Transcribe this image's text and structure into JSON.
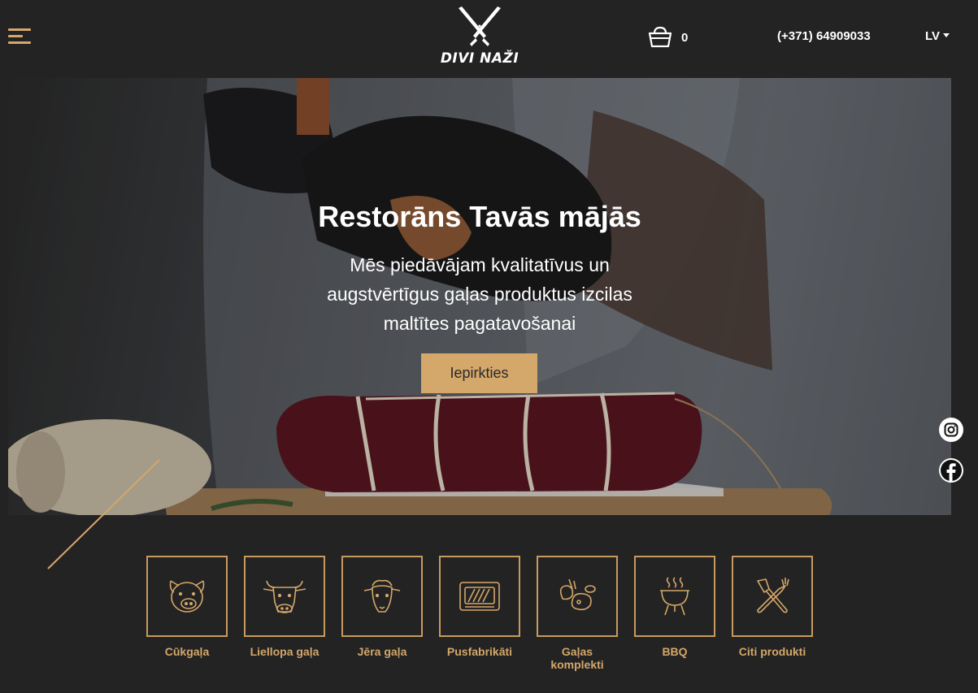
{
  "header": {
    "logo_text": "DIVI NAŽI",
    "cart_count": "0",
    "phone": "(+371) 64909033",
    "language": "LV"
  },
  "hero": {
    "title": "Restorāns Tavās mājās",
    "subtitle": "Mēs piedāvājam kvalitatīvus un augstvērtīgus gaļas produktus izcilas maltītes pagatavošanai",
    "button_label": "Iepirkties"
  },
  "categories": [
    {
      "label": "Cūkgaļa",
      "icon": "pig-icon"
    },
    {
      "label": "Liellopa gaļa",
      "icon": "cow-icon"
    },
    {
      "label": "Jēra gaļa",
      "icon": "sheep-icon"
    },
    {
      "label": "Pusfabrikāti",
      "icon": "steak-icon"
    },
    {
      "label": "Gaļas komplekti",
      "icon": "meat-set-icon"
    },
    {
      "label": "BBQ",
      "icon": "grill-icon"
    },
    {
      "label": "Citi produkti",
      "icon": "utensils-icon"
    }
  ],
  "social": [
    "instagram-icon",
    "facebook-icon"
  ],
  "colors": {
    "background": "#232323",
    "accent": "#d4a76a",
    "text": "#ffffff"
  }
}
